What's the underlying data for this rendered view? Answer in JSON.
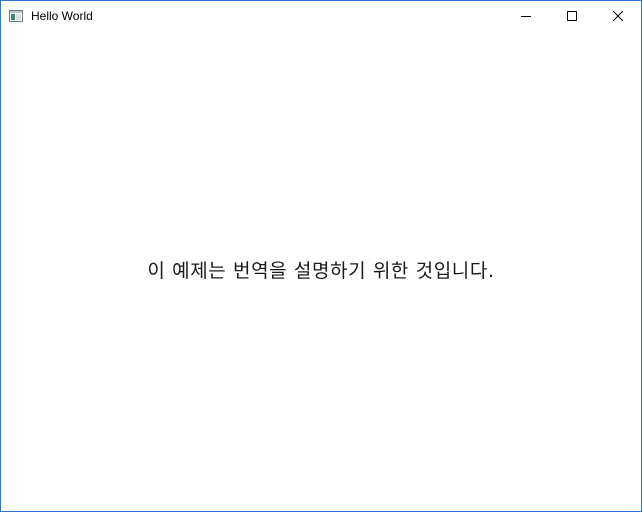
{
  "window": {
    "title": "Hello World",
    "icon": "window-app-icon",
    "controls": {
      "minimize": "minimize-icon",
      "maximize": "maximize-icon",
      "close": "close-icon"
    },
    "border_color": "#2b79d0"
  },
  "content": {
    "message": "이 예제는 번역을 설명하기 위한 것입니다."
  }
}
